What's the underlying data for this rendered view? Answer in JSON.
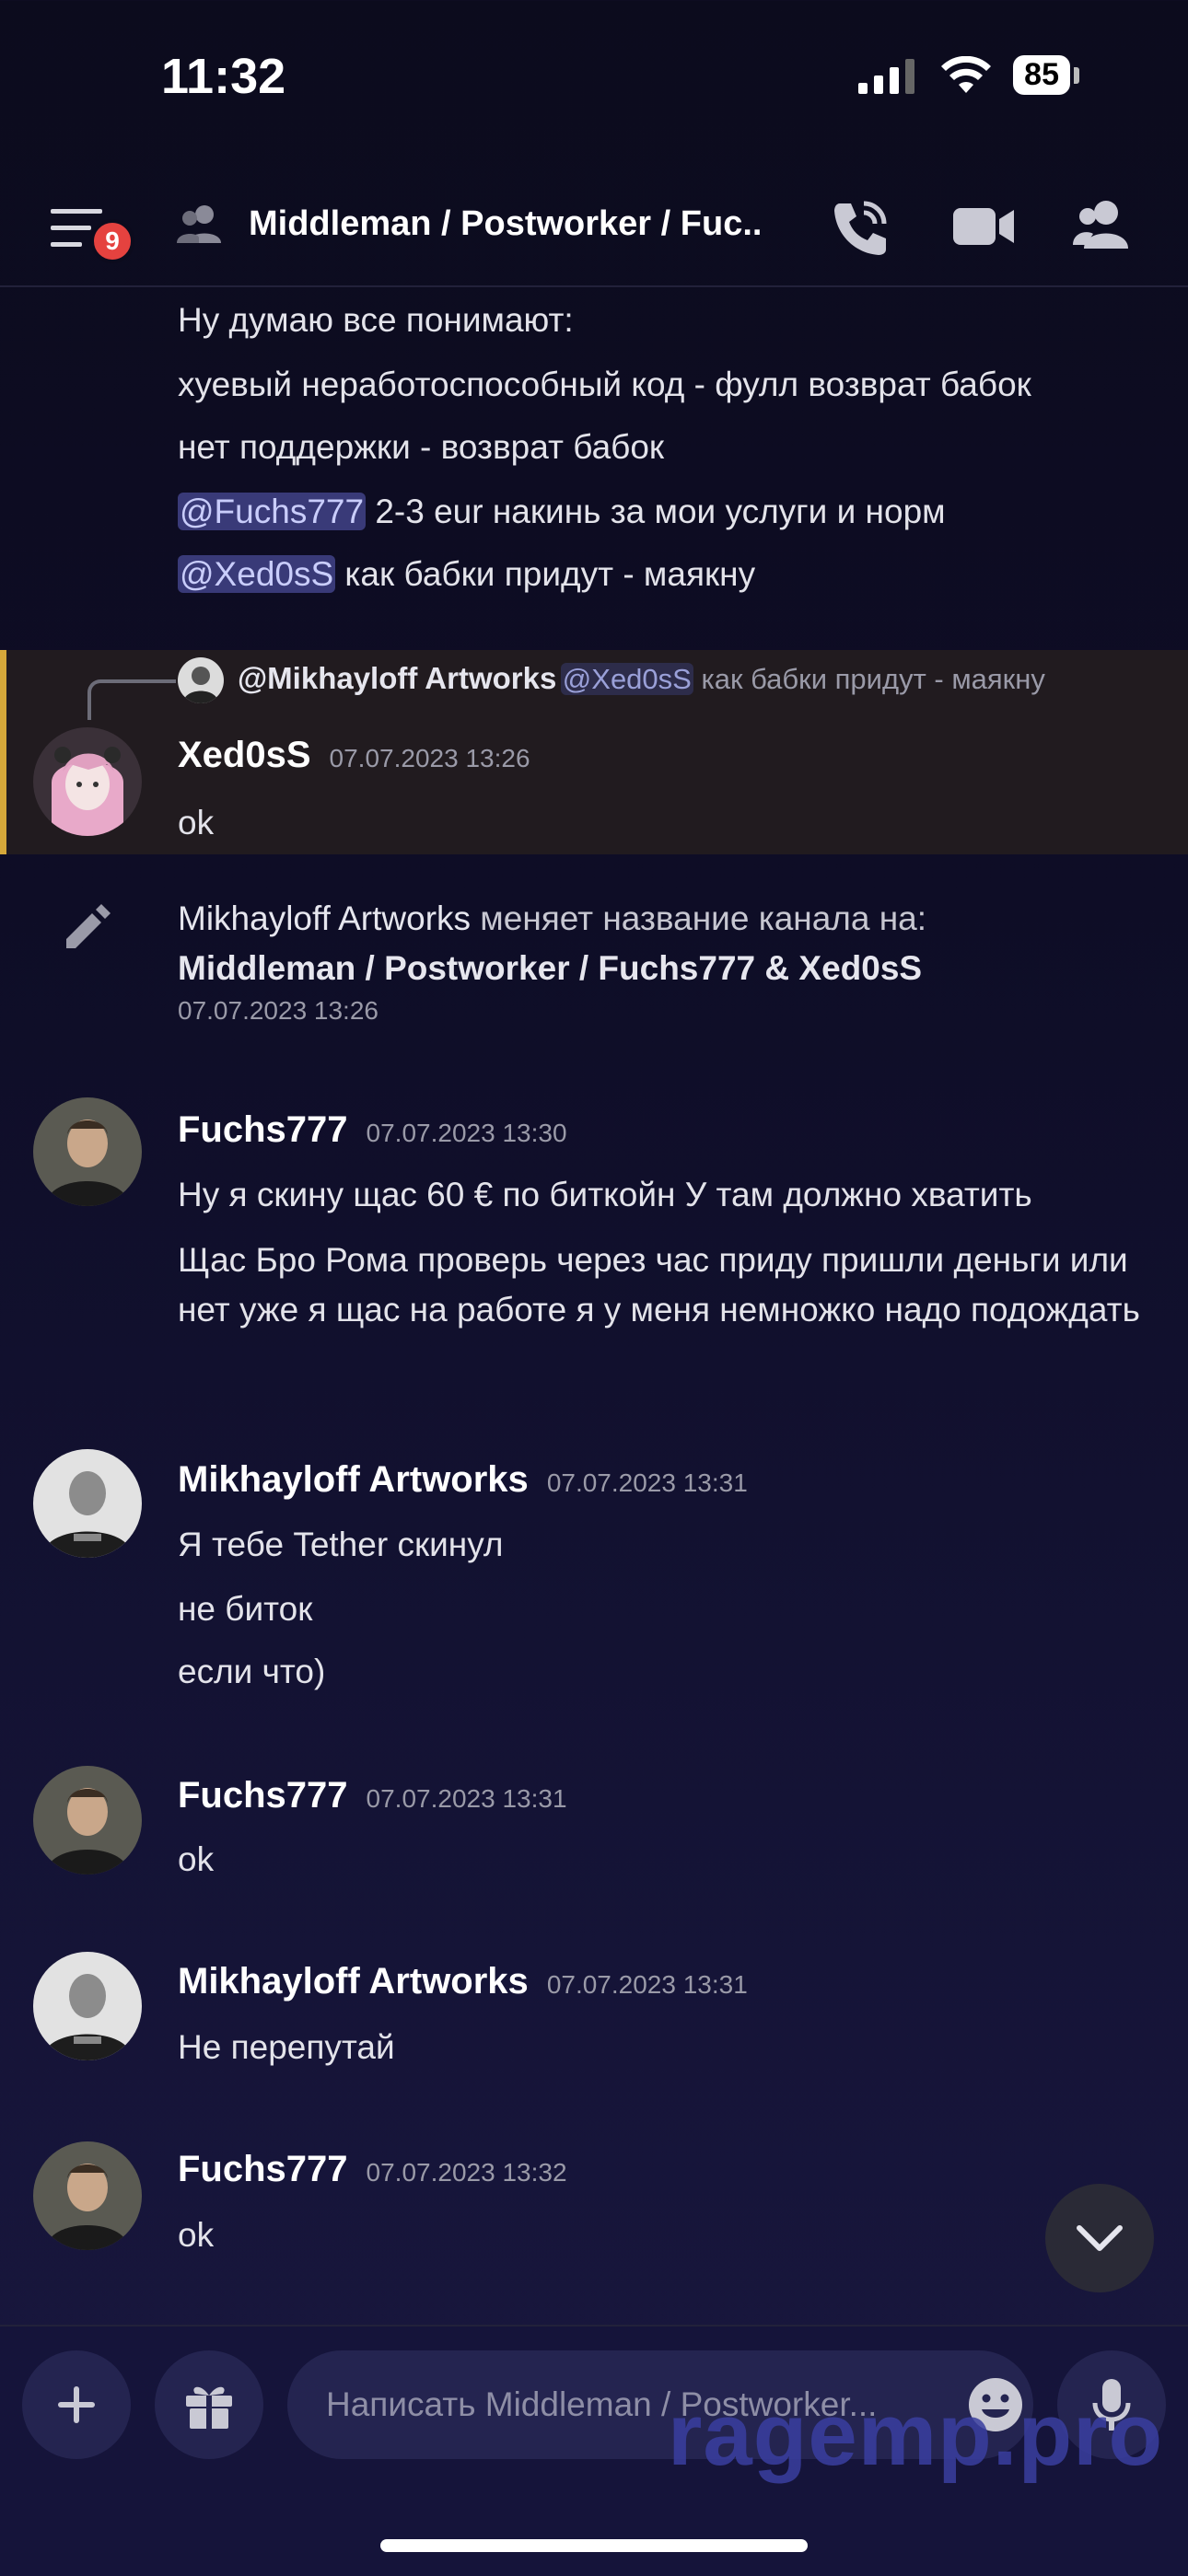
{
  "status_bar": {
    "time": "11:32",
    "battery": "85"
  },
  "header": {
    "badge": "9",
    "title": "Middleman / Postworker / Fuc..."
  },
  "messages_top": [
    "Ну думаю все понимают:",
    "хуевый неработоспособный код - фулл возврат бабок",
    "нет поддержки - возврат бабок"
  ],
  "msg_fuchs_mention": {
    "mention": "@Fuchs777",
    "text": " 2-3 eur накинь за мои услуги и норм"
  },
  "msg_xed_mention": {
    "mention": "@Xed0sS",
    "text": " как бабки придут - маякну"
  },
  "reply": {
    "author": "@Mikhayloff Artworks",
    "mention": "@Xed0sS",
    "text": " как бабки придут - маякну"
  },
  "xed_msg": {
    "name": "Xed0sS",
    "time": "07.07.2023 13:26",
    "text": "ok"
  },
  "system": {
    "actor": "Mikhayloff Artworks",
    "action": " меняет название канала на:",
    "new_name": "Middleman / Postworker / Fuchs777 & Xed0sS",
    "time": "07.07.2023 13:26"
  },
  "m1": {
    "name": "Fuchs777",
    "time": "07.07.2023 13:30",
    "lines": [
      "Ну я скину щас 60 € по биткойн У там должно хватить",
      "Щас Бро Рома проверь через час приду пришли деньги или нет уже я щас на работе я у меня немножко надо подождать"
    ]
  },
  "m2": {
    "name": "Mikhayloff Artworks",
    "time": "07.07.2023 13:31",
    "lines": [
      "Я тебе Tether скинул",
      "не биток",
      "если что)"
    ]
  },
  "m3": {
    "name": "Fuchs777",
    "time": "07.07.2023 13:31",
    "text": "ok"
  },
  "m4": {
    "name": "Mikhayloff Artworks",
    "time": "07.07.2023 13:31",
    "text": "Не перепутай"
  },
  "m5": {
    "name": "Fuchs777",
    "time": "07.07.2023 13:32",
    "text": "ok"
  },
  "composer": {
    "placeholder": "Написать Middleman / Postworker..."
  },
  "watermark": "ragemp.pro",
  "colors": {
    "accent_mention": "#393a78",
    "highlight_border": "#d6a83a",
    "badge": "#e5423f"
  }
}
